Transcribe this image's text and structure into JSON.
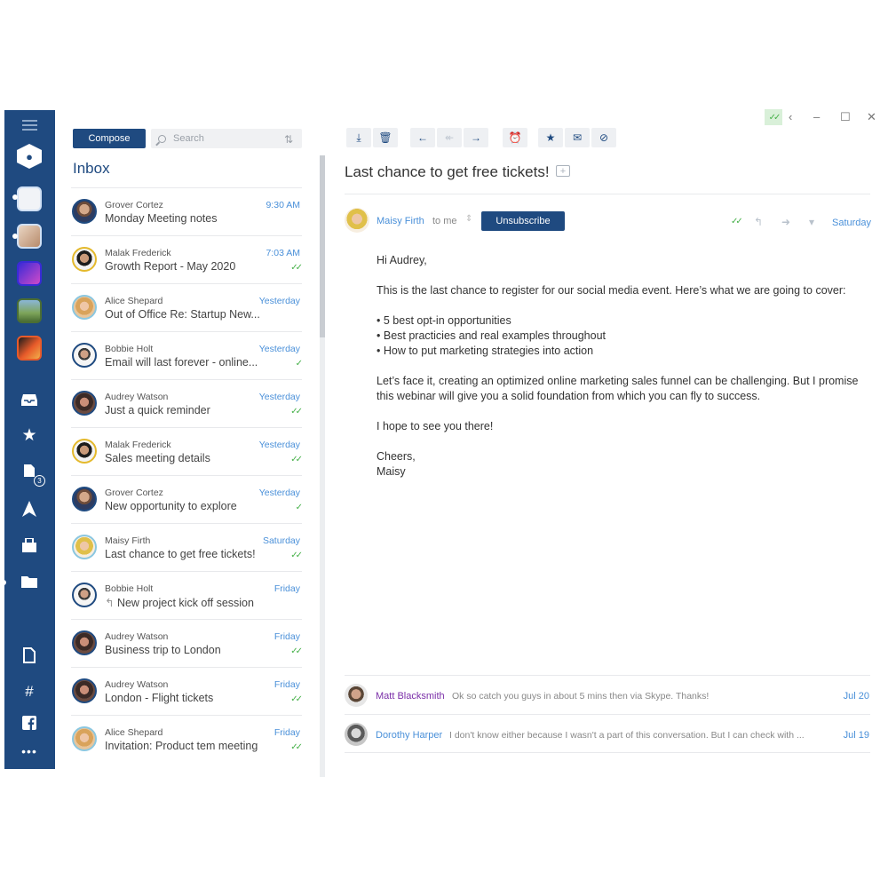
{
  "sidebar": {
    "menu_icon": "hamburger-icon",
    "contacts_icon": "people-icon",
    "accounts": [
      "account-1",
      "account-2",
      "account-3",
      "account-4",
      "account-5"
    ],
    "folder_icons": [
      "inbox-icon",
      "star-icon",
      "snooze-icon",
      "send-icon",
      "archive-icon",
      "folder-icon"
    ],
    "snooze_badge": "3",
    "bottom_icons": [
      "file-icon",
      "slack-icon",
      "facebook-icon",
      "more-icon"
    ]
  },
  "list": {
    "compose_label": "Compose",
    "search_placeholder": "Search",
    "title": "Inbox",
    "items": [
      {
        "name": "Grover Cortez",
        "subject": "Monday Meeting notes",
        "time": "9:30 AM",
        "check": ""
      },
      {
        "name": "Malak Frederick",
        "subject": "Growth Report - May 2020",
        "time": "7:03 AM",
        "check": "✓✓"
      },
      {
        "name": "Alice Shepard",
        "subject": "Out of Office Re: Startup New...",
        "time": "Yesterday",
        "check": ""
      },
      {
        "name": "Bobbie Holt",
        "subject": "Email will last forever - online...",
        "time": "Yesterday",
        "check": "✓"
      },
      {
        "name": "Audrey Watson",
        "subject": "Just a quick reminder",
        "time": "Yesterday",
        "check": "✓✓"
      },
      {
        "name": "Malak Frederick",
        "subject": "Sales meeting details",
        "time": "Yesterday",
        "check": "✓✓"
      },
      {
        "name": "Grover Cortez",
        "subject": "New opportunity to explore",
        "time": "Yesterday",
        "check": "✓"
      },
      {
        "name": "Maisy Firth",
        "subject": "Last chance to get free tickets!",
        "time": "Saturday",
        "check": "✓✓"
      },
      {
        "name": "Bobbie Holt",
        "subject": "New project kick off session",
        "time": "Friday",
        "check": ""
      },
      {
        "name": "Audrey Watson",
        "subject": "Business trip to London",
        "time": "Friday",
        "check": "✓✓"
      },
      {
        "name": "Audrey Watson",
        "subject": "London - Flight tickets",
        "time": "Friday",
        "check": "✓✓"
      },
      {
        "name": "Alice Shepard",
        "subject": "Invitation: Product tem meeting",
        "time": "Friday",
        "check": "✓✓"
      }
    ]
  },
  "toolbar": {
    "buttons": [
      "download-icon",
      "trash-icon",
      "reply-icon",
      "reply-all-icon",
      "forward-icon",
      "snooze-icon",
      "star-icon",
      "mark-read-icon",
      "block-icon"
    ]
  },
  "message": {
    "subject": "Last chance to get free tickets!",
    "sender": "Maisy Firth",
    "to": "to me",
    "unsubscribe_label": "Unsubscribe",
    "date": "Saturday",
    "greeting": "Hi Audrey,",
    "intro": "This is the last chance to register for our social media event. Here’s what we are going to cover:",
    "bullets": [
      "5 best opt-in opportunities",
      "Best practicies and real examples throughout",
      "How to put marketing strategies into action"
    ],
    "para": "Let’s face it, creating an optimized online marketing sales funnel can be challenging. But I promise this webinar will give you a solid foundation from which you can fly to success.",
    "closing": "I hope to see you there!",
    "signoff": "Cheers,",
    "signature": "Maisy"
  },
  "thread": [
    {
      "name": "Matt Blacksmith",
      "preview": "Ok so catch you guys in about 5 mins then via Skype. Thanks!",
      "date": "Jul 20",
      "color": "#7b2fa8"
    },
    {
      "name": "Dorothy Harper",
      "preview": "I don't know either because I wasn't a part of this conversation. But I can check with ...",
      "date": "Jul 19",
      "color": "#4a90d9"
    }
  ],
  "colors": {
    "brand": "#1f4a80",
    "accent": "#4a90d9",
    "check": "#47b14a"
  }
}
